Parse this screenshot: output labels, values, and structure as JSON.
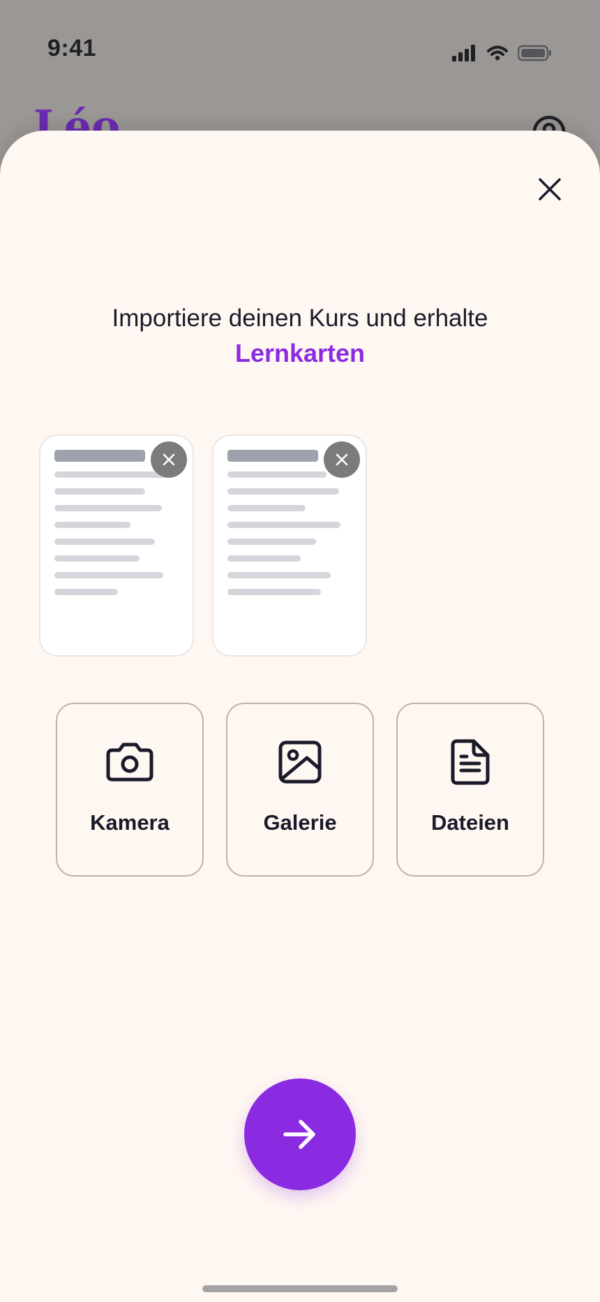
{
  "status_bar": {
    "time": "9:41"
  },
  "background_app": {
    "logo_text": "Léo"
  },
  "sheet": {
    "headline": {
      "line1": "Importiere deinen Kurs und erhalte",
      "highlight": "Lernkarten"
    },
    "documents": [
      {
        "name": "document-1"
      },
      {
        "name": "document-2"
      }
    ],
    "sources": [
      {
        "label": "Kamera",
        "icon": "camera-icon"
      },
      {
        "label": "Galerie",
        "icon": "image-icon"
      },
      {
        "label": "Dateien",
        "icon": "file-icon"
      }
    ],
    "next_button_icon": "arrow-right-icon"
  },
  "colors": {
    "accent": "#8a2be2",
    "sheet_background": "#fff8f2",
    "overlay": "#9a9794",
    "text": "#1a1a2a"
  }
}
